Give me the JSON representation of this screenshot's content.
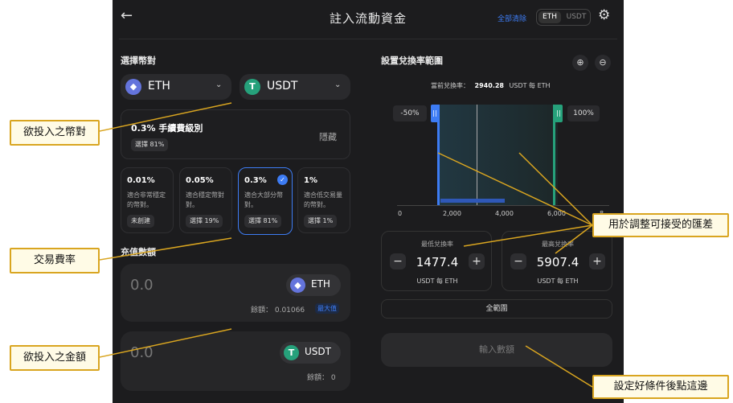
{
  "header": {
    "title": "註入流動資金",
    "clear_all": "全部清除",
    "toggle_eth": "ETH",
    "toggle_usdt": "USDT"
  },
  "pair": {
    "section_label": "選擇幣對",
    "token_a": "ETH",
    "token_b": "USDT"
  },
  "fee_tier": {
    "title": "0.3% 手續費級別",
    "selected_badge": "選擇 81%",
    "hide_label": "隱藏",
    "options": [
      {
        "pct": "0.01%",
        "desc_line1": "適合非常穩定",
        "desc_line2": "的幣對。",
        "badge": "未創建"
      },
      {
        "pct": "0.05%",
        "desc_line1": "適合穩定幣對",
        "desc_line2": "對。",
        "badge": "選擇 19%"
      },
      {
        "pct": "0.3%",
        "desc_line1": "適合大部分幣",
        "desc_line2": "對。",
        "badge": "選擇 81%"
      },
      {
        "pct": "1%",
        "desc_line1": "適合低交易量",
        "desc_line2": "的幣對。",
        "badge": "選擇 1%"
      }
    ]
  },
  "deposit": {
    "section_label": "充值數額",
    "amount_a": "0.0",
    "token_a": "ETH",
    "balance_a": "餘額： 0.01066",
    "max": "最大值",
    "amount_b": "0.0",
    "token_b": "USDT",
    "balance_b": "餘額： 0"
  },
  "range": {
    "section_label": "設置兌換率範圍",
    "current_label": "當前兌換率：",
    "current_value": "2940.28",
    "current_unit": "USDT 每 ETH",
    "min_pct": "-50%",
    "max_pct": "100%",
    "axis_ticks": [
      "0",
      "2,000",
      "4,000",
      "6,000",
      "8"
    ],
    "min_label": "最低兌換率",
    "min_value": "1477.4",
    "min_unit": "USDT 每 ETH",
    "max_label": "最高兌換率",
    "max_value": "5907.4",
    "max_unit": "USDT 每 ETH",
    "full_range": "全範圍",
    "enter_amount": "輸入數額"
  },
  "callouts": {
    "pair": "欲投入之幣對",
    "fee": "交易費率",
    "amount": "欲投入之金額",
    "range": "用於調整可接受的匯差",
    "confirm": "設定好條件後點這邊"
  },
  "icons": {
    "back": "←",
    "gear": "⚙",
    "zoom_in": "⊕",
    "zoom_out": "⊖",
    "chevron": "⌄",
    "eth": "◆",
    "usdt": "T",
    "check": "✓",
    "minus": "−",
    "plus": "+"
  }
}
